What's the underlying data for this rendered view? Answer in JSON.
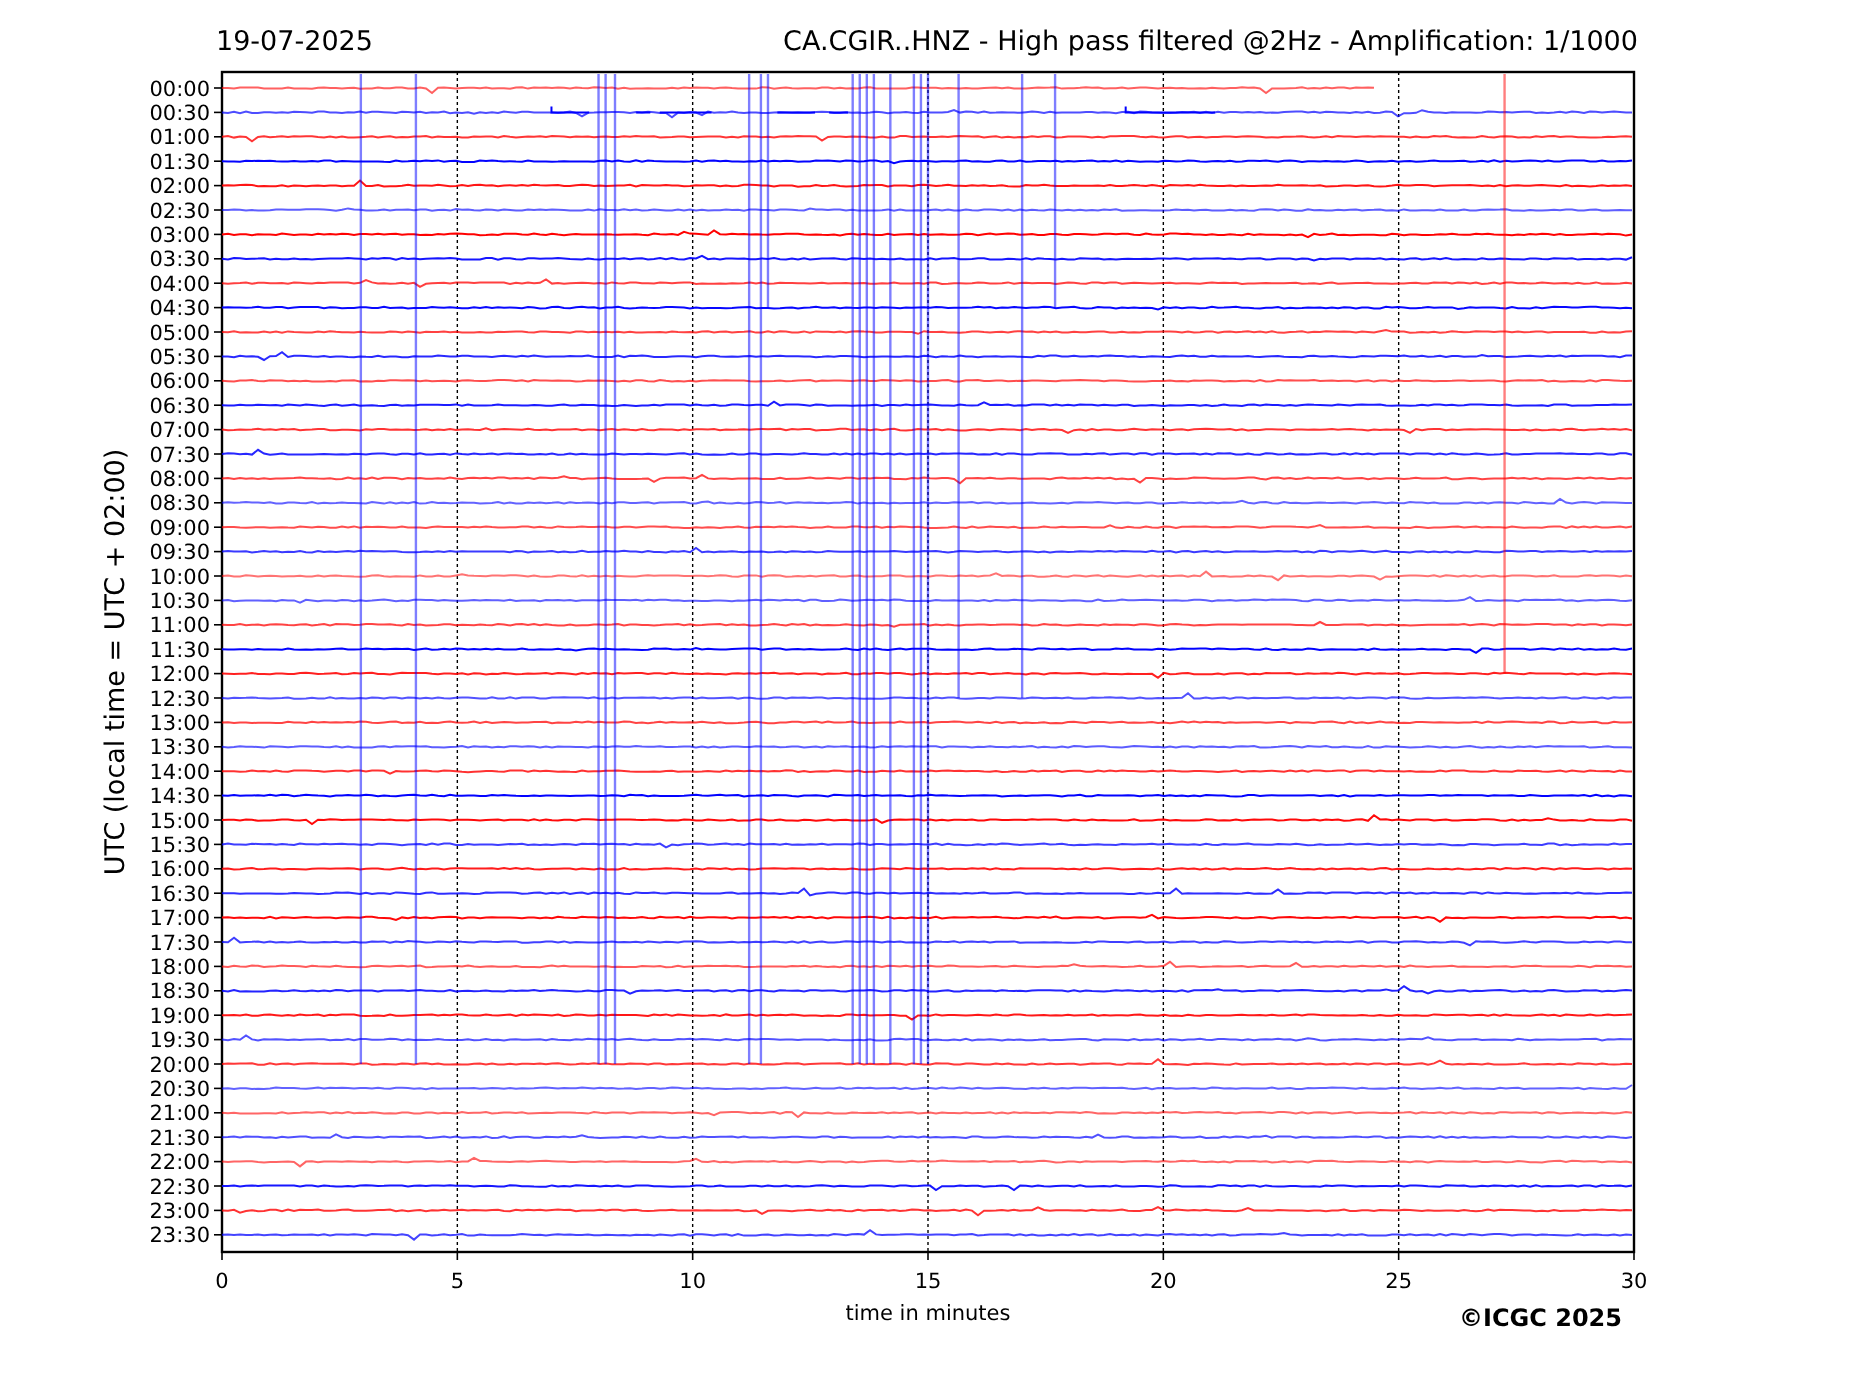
{
  "header": {
    "date": "19-07-2025",
    "title": "CA.CGIR..HNZ - High pass filtered @2Hz - Amplification: 1/1000"
  },
  "plot": {
    "ylabel": "UTC (local time = UTC + 02:00)",
    "xlabel": "time in minutes",
    "yticks": [
      "00:00",
      "00:30",
      "01:00",
      "01:30",
      "02:00",
      "02:30",
      "03:00",
      "03:30",
      "04:00",
      "04:30",
      "05:00",
      "05:30",
      "06:00",
      "06:30",
      "07:00",
      "07:30",
      "08:00",
      "08:30",
      "09:00",
      "09:30",
      "10:00",
      "10:30",
      "11:00",
      "11:30",
      "12:00",
      "12:30",
      "13:00",
      "13:30",
      "14:00",
      "14:30",
      "15:00",
      "15:30",
      "16:00",
      "16:30",
      "17:00",
      "17:30",
      "18:00",
      "18:30",
      "19:00",
      "19:30",
      "20:00",
      "20:30",
      "21:00",
      "21:30",
      "22:00",
      "22:30",
      "23:00",
      "23:30"
    ],
    "xticks": [
      "0",
      "5",
      "10",
      "15",
      "20",
      "25",
      "30"
    ]
  },
  "credit": "©ICGC 2025"
}
